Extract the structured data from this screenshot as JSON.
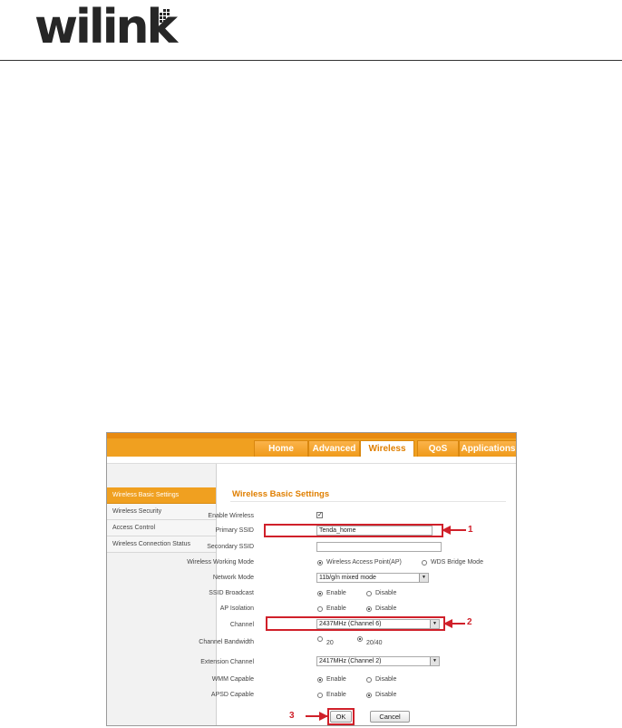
{
  "header": {
    "logo_text": "wilink"
  },
  "router_ui": {
    "nav_tabs": [
      "Home",
      "Advanced",
      "Wireless",
      "QoS",
      "Applications"
    ],
    "active_tab": "Wireless",
    "sidebar": [
      "Wireless Basic Settings",
      "Wireless Security",
      "Access Control",
      "Wireless Connection Status"
    ],
    "page_title": "Wireless Basic Settings",
    "fields": {
      "enable_wireless": "Enable Wireless",
      "primary_ssid": "Primary SSID",
      "primary_ssid_value": "Tenda_home",
      "secondary_ssid": "Secondary SSID",
      "working_mode": "Wireless Working Mode",
      "working_mode_ap": "Wireless Access Point(AP)",
      "working_mode_wds": "WDS Bridge Mode",
      "network_mode": "Network Mode",
      "network_mode_value": "11b/g/n mixed mode",
      "ssid_broadcast": "SSID Broadcast",
      "ap_isolation": "AP Isolation",
      "channel": "Channel",
      "channel_value": "2437MHz (Channel 6)",
      "channel_bandwidth": "Channel Bandwidth",
      "bw_20": "20",
      "bw_2040": "20/40",
      "extension_channel": "Extension Channel",
      "extension_channel_value": "2417MHz (Channel 2)",
      "wmm_capable": "WMM Capable",
      "apsd_capable": "APSD Capable",
      "enable": "Enable",
      "disable": "Disable"
    },
    "buttons": {
      "ok": "OK",
      "cancel": "Cancel"
    }
  },
  "callouts": [
    "1",
    "2",
    "3"
  ],
  "colors": {
    "accent": "#f0a020",
    "callout": "#d0202a"
  }
}
